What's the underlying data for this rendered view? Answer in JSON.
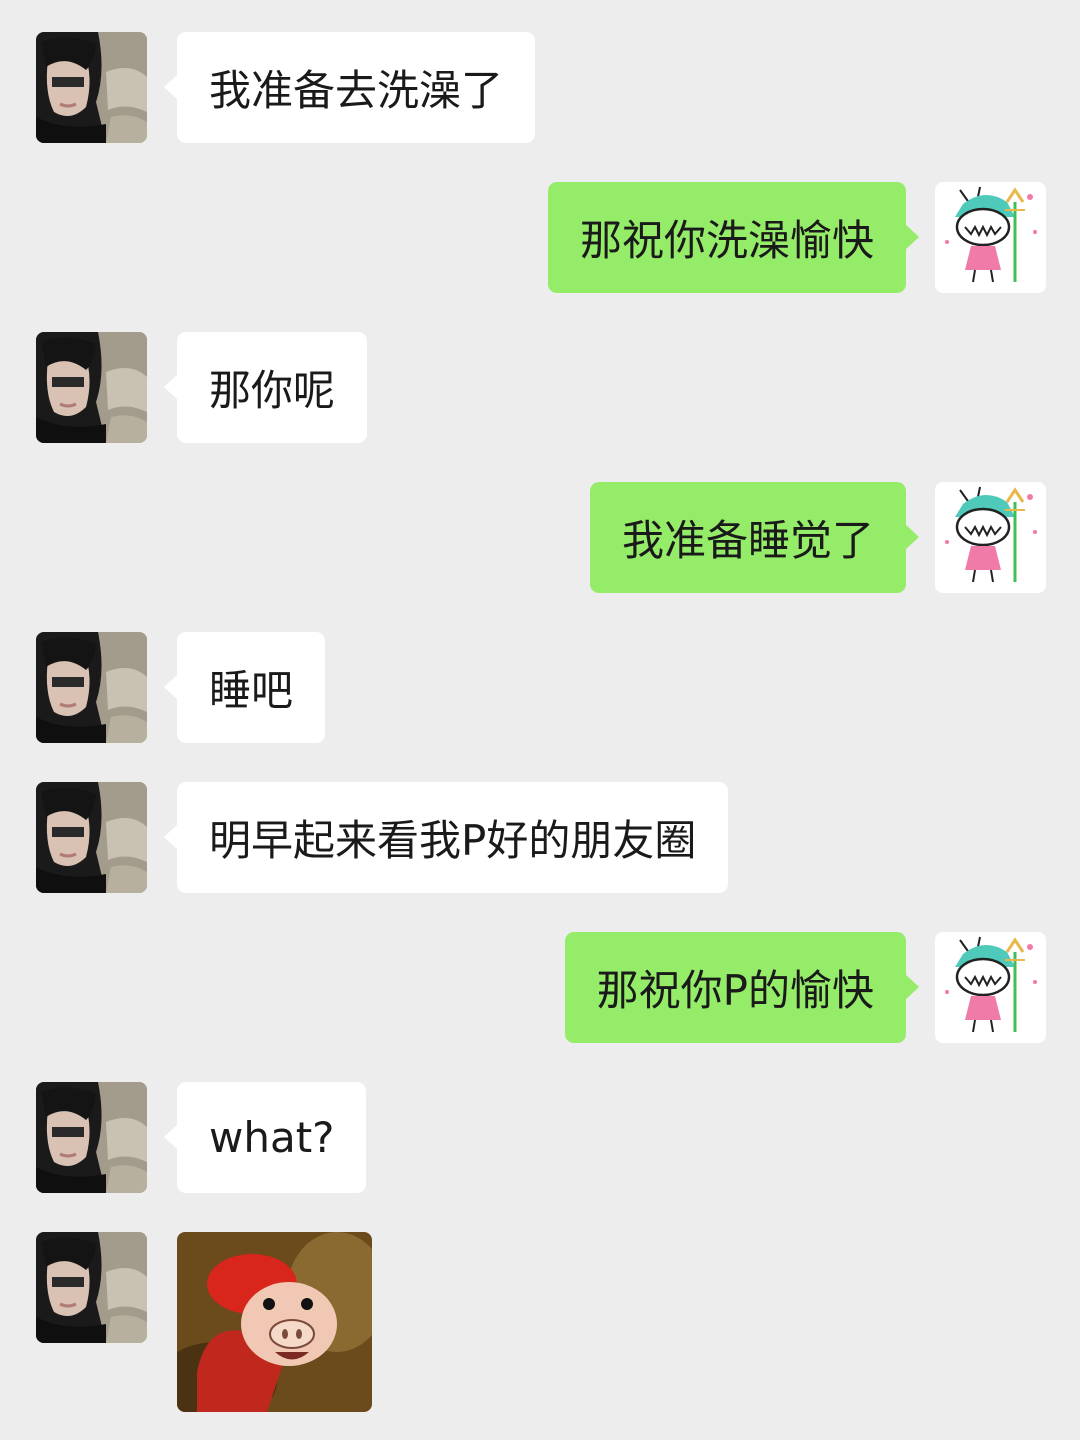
{
  "chat": {
    "messages": [
      {
        "side": "left",
        "text": "我准备去洗澡了"
      },
      {
        "side": "right",
        "text": "那祝你洗澡愉快"
      },
      {
        "side": "left",
        "text": "那你呢"
      },
      {
        "side": "right",
        "text": "我准备睡觉了"
      },
      {
        "side": "left",
        "text": "睡吧"
      },
      {
        "side": "left",
        "text": "明早起来看我P好的朋友圈"
      },
      {
        "side": "right",
        "text": "那祝你P的愉快"
      },
      {
        "side": "left",
        "text": "what?"
      },
      {
        "side": "left",
        "type": "sticker",
        "sticker": "cartoon-pig-sticker"
      }
    ]
  },
  "colors": {
    "background": "#ededed",
    "incoming_bubble": "#ffffff",
    "outgoing_bubble": "#95ec69"
  },
  "icons": {
    "contact_avatar": "contact-avatar-photo",
    "self_avatar": "self-avatar-drawing"
  }
}
